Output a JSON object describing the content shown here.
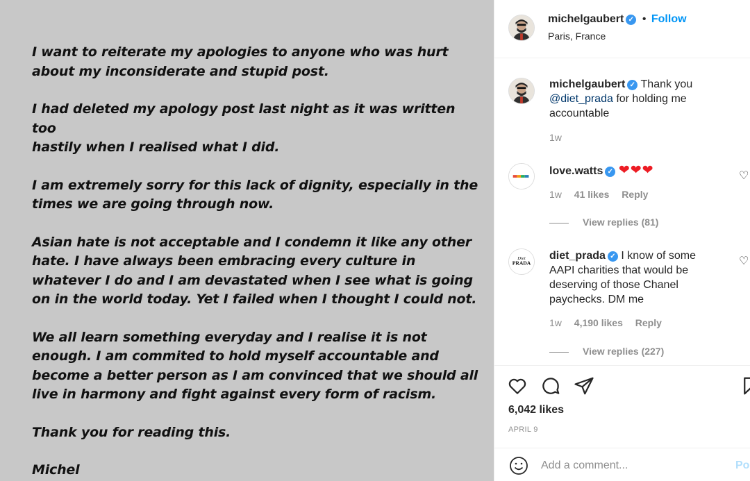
{
  "image": {
    "paragraphs": [
      "I want to reiterate my apologies to anyone who was hurt\nabout my inconsiderate and stupid post.",
      "I had deleted my apology post last night as it was written too\nhastily when I realised what I did.",
      "I am extremely sorry for this lack of dignity, especially in the\ntimes we are going through now.",
      "Asian hate is not acceptable and I condemn it like any other\nhate. I have always been embracing  every culture in\nwhatever I do and  I am devastated when I see what is going\non in the world today. Yet I failed when I thought I could not.",
      "We all learn something everyday and I realise it is not\nenough. I am commited to hold myself accountable and\nbecome a better person as I am convinced that we should all\nlive in harmony and fight against every form of racism.",
      "Thank you for reading this.",
      "Michel"
    ]
  },
  "header": {
    "username": "michelgaubert",
    "separator": "•",
    "follow_label": "Follow",
    "location": "Paris, France",
    "more_icon": "more-icon"
  },
  "comments": [
    {
      "username": "michelgaubert",
      "text_before": "Thank you",
      "mention": "@diet_prada",
      "text_after": "for holding me accountable",
      "time": "1w"
    },
    {
      "username": "love.watts",
      "text": "❤❤❤",
      "time": "1w",
      "likes": "41 likes",
      "reply": "Reply",
      "view_replies": "View replies (81)"
    },
    {
      "username": "diet_prada",
      "text": "I know of some AAPI charities that would be deserving of those Chanel paychecks. DM me",
      "time": "1w",
      "likes": "4,190 likes",
      "reply": "Reply",
      "view_replies": "View replies (227)",
      "avatar_text": "Diet PRADA"
    }
  ],
  "actions": {
    "icons": [
      "heart-icon",
      "comment-icon",
      "share-icon",
      "bookmark-icon"
    ],
    "likes": "6,042 likes",
    "date": "APRIL 9"
  },
  "add_comment": {
    "placeholder": "Add a comment...",
    "post_label": "Post"
  },
  "colors": {
    "accent": "#0095f6",
    "verified": "#3897f0",
    "muted": "#8e8e8e",
    "image_bg": "#c8c8c8",
    "hearts": "#ed1c24"
  }
}
